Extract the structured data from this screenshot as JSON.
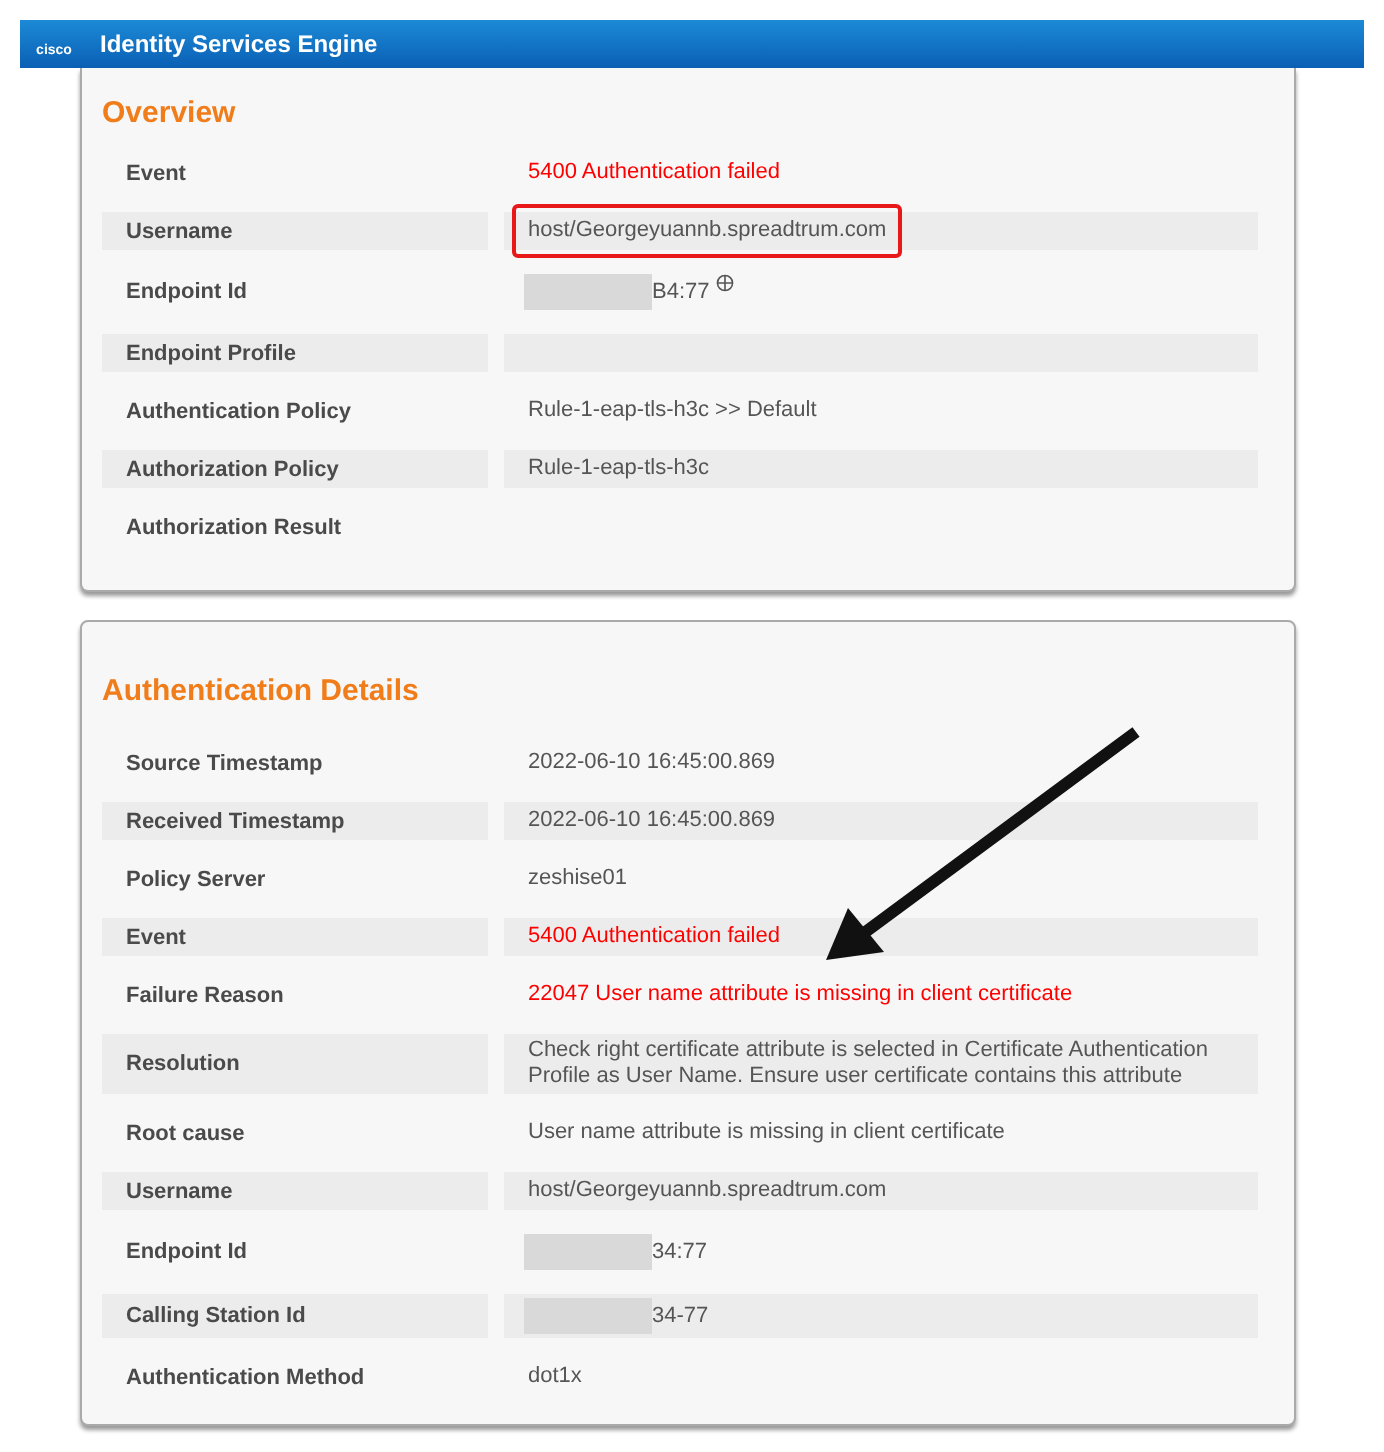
{
  "header": {
    "logo_text": "cisco",
    "title": "Identity Services Engine"
  },
  "sections": [
    {
      "title": "Overview",
      "rows": [
        {
          "label": "Event",
          "value": "5400 Authentication failed",
          "alert": true
        },
        {
          "label": "Username",
          "value": "host/Georgeyuannb.spreadtrum.com",
          "highlighted": true
        },
        {
          "label": "Endpoint Id",
          "value": "B4:77",
          "redacted": true,
          "lookup": true
        },
        {
          "label": "Endpoint Profile"
        },
        {
          "label": "Authentication Policy",
          "value": "Rule-1-eap-tls-h3c >> Default"
        },
        {
          "label": "Authorization Policy",
          "value": "Rule-1-eap-tls-h3c"
        },
        {
          "label": "Authorization Result"
        }
      ]
    },
    {
      "title": "Authentication Details",
      "rows": [
        {
          "label": "Source Timestamp",
          "value": "2022-06-10 16:45:00.869"
        },
        {
          "label": "Received Timestamp",
          "value": "2022-06-10 16:45:00.869"
        },
        {
          "label": "Policy Server",
          "value": "zeshise01"
        },
        {
          "label": "Event",
          "value": "5400 Authentication failed",
          "alert": true
        },
        {
          "label": "Failure Reason",
          "value": "22047 User name attribute is missing in client certificate",
          "alert": true
        },
        {
          "label": "Resolution",
          "value": "Check right certificate attribute is selected in Certificate Authentication Profile as User Name. Ensure user certificate contains this attribute"
        },
        {
          "label": "Root cause",
          "value": "User name attribute is missing in client certificate"
        },
        {
          "label": "Username",
          "value": "host/Georgeyuannb.spreadtrum.com"
        },
        {
          "label": "Endpoint Id",
          "value": "34:77",
          "redacted": true
        },
        {
          "label": "Calling Station Id",
          "value": "34-77",
          "redacted": true
        },
        {
          "label": "Authentication Method",
          "value": "dot1x"
        }
      ]
    }
  ]
}
